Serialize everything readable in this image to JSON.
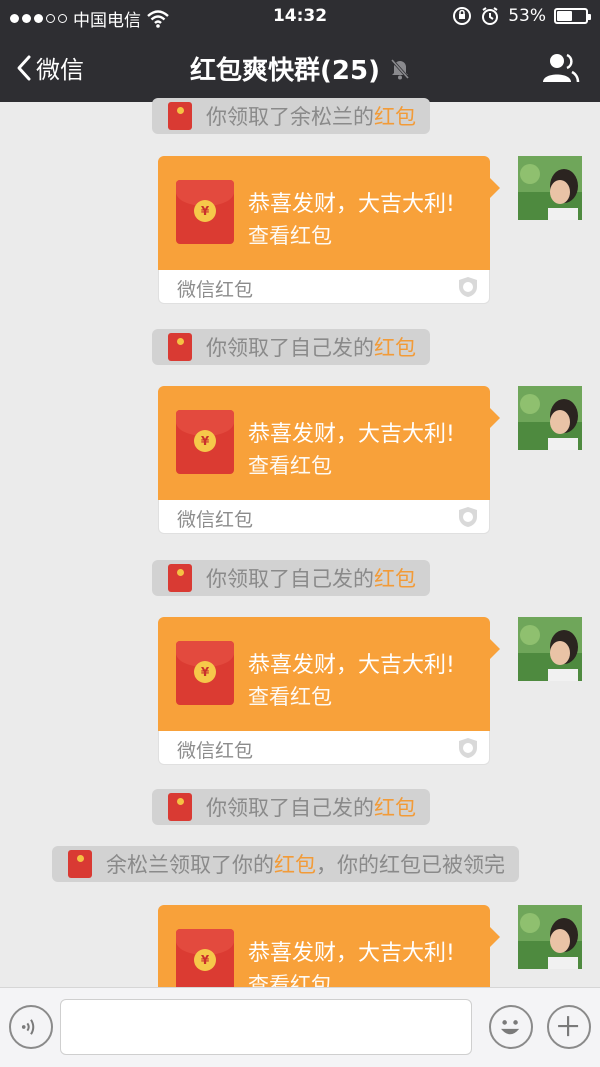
{
  "status_bar": {
    "carrier": "中国电信",
    "time": "14:32",
    "battery": "53%",
    "battery_level": 0.53,
    "signal_bars_filled": 3,
    "signal_bars_total": 5
  },
  "nav": {
    "back_label": "微信",
    "title": "红包爽快群(25)"
  },
  "system_messages": [
    {
      "prefix": "你领取了余松兰的",
      "highlight": "红包",
      "suffix": ""
    },
    {
      "prefix": "你领取了自己发的",
      "highlight": "红包",
      "suffix": ""
    },
    {
      "prefix": "你领取了自己发的",
      "highlight": "红包",
      "suffix": ""
    },
    {
      "prefix": "你领取了自己发的",
      "highlight": "红包",
      "suffix": ""
    },
    {
      "prefix": "余松兰领取了你的",
      "highlight": "红包",
      "suffix": "，你的红包已被领完"
    }
  ],
  "red_packets": [
    {
      "message": "恭喜发财，大吉大利!",
      "action": "查看红包",
      "footer": "微信红包"
    },
    {
      "message": "恭喜发财，大吉大利!",
      "action": "查看红包",
      "footer": "微信红包"
    },
    {
      "message": "恭喜发财，大吉大利!",
      "action": "查看红包",
      "footer": "微信红包"
    },
    {
      "message": "恭喜发财，大吉大利!",
      "action": "查看红包",
      "footer": ""
    }
  ],
  "coin_symbol": "¥",
  "input": {
    "placeholder": ""
  },
  "colors": {
    "nav_bg": "#2e2e32",
    "chat_bg": "#ebebeb",
    "packet_orange": "#f8a13a",
    "envelope_red": "#db3b32",
    "highlight": "#f29b38"
  }
}
